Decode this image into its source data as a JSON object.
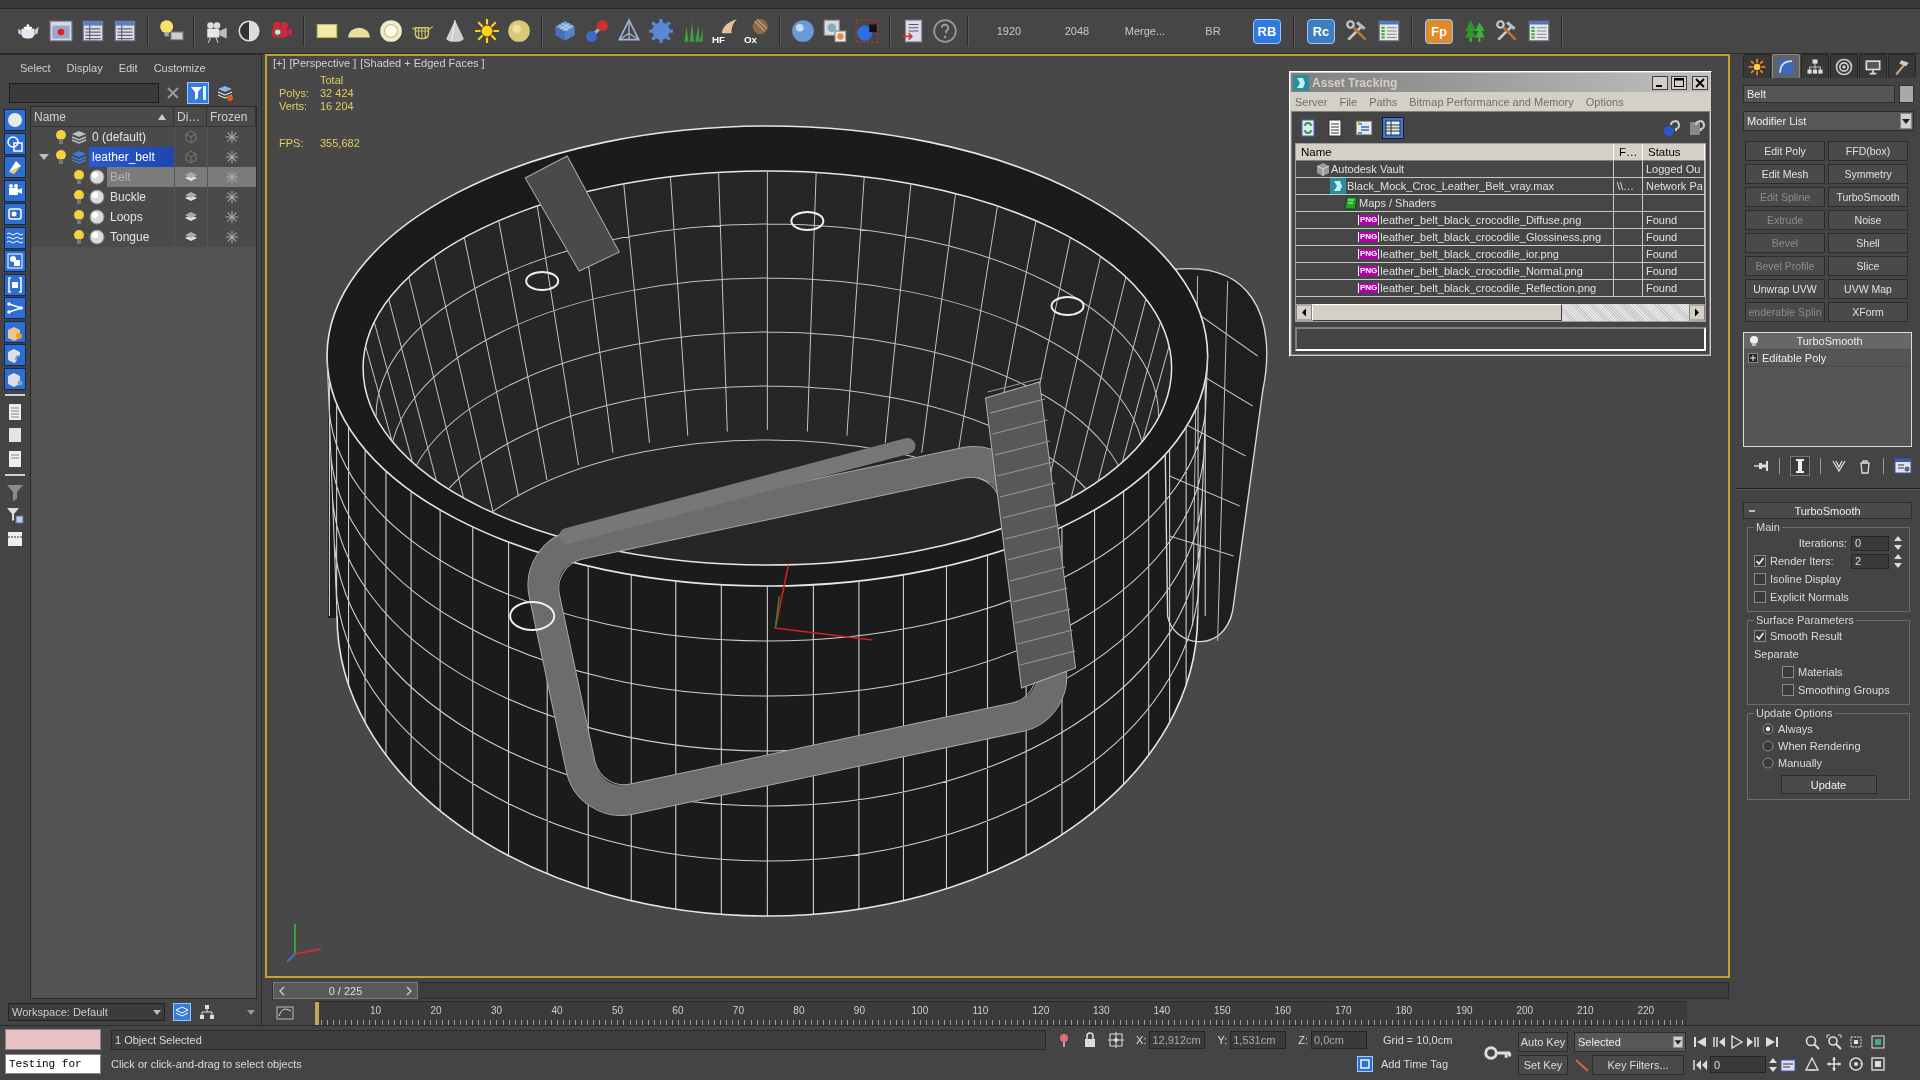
{
  "main_toolbar": {
    "texts": [
      "1920",
      "2048",
      "Merge...",
      "BR"
    ],
    "icon_captions": [
      "HF",
      "Ox"
    ],
    "logo_buttons": [
      {
        "label": "RB",
        "color": "#2d7be0"
      },
      {
        "label": "Rc",
        "color": "#3f7fc0"
      },
      {
        "label": "Fp",
        "color": "#e08a2a"
      }
    ]
  },
  "scene_explorer": {
    "menu": [
      "Select",
      "Display",
      "Edit",
      "Customize"
    ],
    "columns": [
      "Name",
      "Di…",
      "Frozen"
    ],
    "tree": [
      {
        "name": "0 (default)",
        "kind": "layer",
        "visible": true,
        "active": false,
        "selected": false
      },
      {
        "name": "leather_belt",
        "kind": "layer",
        "visible": true,
        "active": true,
        "selected": false,
        "expanded": true,
        "children": [
          {
            "name": "Belt",
            "kind": "object",
            "visible": true,
            "selected": true
          },
          {
            "name": "Buckle",
            "kind": "object",
            "visible": true,
            "selected": false
          },
          {
            "name": "Loops",
            "kind": "object",
            "visible": true,
            "selected": false
          },
          {
            "name": "Tongue",
            "kind": "object",
            "visible": true,
            "selected": false
          }
        ]
      }
    ],
    "workspace": "Workspace: Default"
  },
  "viewport": {
    "active": true,
    "labels": [
      "[+]",
      "[Perspective ]",
      "[Shaded + Edged Faces ]"
    ],
    "stats_heading": "Total",
    "stats": [
      {
        "label": "Polys:",
        "value": "32 424"
      },
      {
        "label": "Verts:",
        "value": "16 204"
      }
    ],
    "fps": {
      "label": "FPS:",
      "value": "355,682"
    }
  },
  "asset_tracking": {
    "title": "Asset Tracking",
    "focused": false,
    "menu": [
      "Server",
      "File",
      "Paths",
      "Bitmap Performance and Memory",
      "Options"
    ],
    "view_modes": [
      {
        "kind": "list",
        "selected": false
      },
      {
        "kind": "tree",
        "selected": false
      },
      {
        "kind": "table",
        "selected": true
      }
    ],
    "columns": [
      "Name",
      "F…",
      "Status"
    ],
    "tree": [
      {
        "name": "Autodesk Vault",
        "kind": "vault",
        "status": "Logged Ou",
        "children": [
          {
            "name": "Black_Mock_Croc_Leather_Belt_vray.max",
            "kind": "scene",
            "column_2": "\\\\…",
            "status": "Network Pa",
            "children": [
              {
                "name": "Maps / Shaders",
                "kind": "folder",
                "children": [
                  {
                    "name": "leather_belt_black_crocodile_Diffuse.png",
                    "kind": "file",
                    "badge": "PNG",
                    "status": "Found"
                  },
                  {
                    "name": "leather_belt_black_crocodile_Glossiness.png",
                    "kind": "file",
                    "badge": "PNG",
                    "status": "Found"
                  },
                  {
                    "name": "leather_belt_black_crocodile_ior.png",
                    "kind": "file",
                    "badge": "PNG",
                    "status": "Found"
                  },
                  {
                    "name": "leather_belt_black_crocodile_Normal.png",
                    "kind": "file",
                    "badge": "PNG",
                    "status": "Found"
                  },
                  {
                    "name": "leather_belt_black_crocodile_Reflection.png",
                    "kind": "file",
                    "badge": "PNG",
                    "status": "Found"
                  }
                ]
              }
            ]
          }
        ]
      }
    ]
  },
  "command_panel": {
    "tabs": [
      {
        "kind": "create",
        "selected": false
      },
      {
        "kind": "modify",
        "selected": true
      },
      {
        "kind": "hierarchy",
        "selected": false
      },
      {
        "kind": "motion",
        "selected": false
      },
      {
        "kind": "display",
        "selected": false
      },
      {
        "kind": "utilities",
        "selected": false
      }
    ],
    "object_name": "Belt",
    "modifier_list": "Modifier List",
    "modifier_buttons": [
      {
        "label": "Edit Poly",
        "disabled": false
      },
      {
        "label": "FFD(box)",
        "disabled": false
      },
      {
        "label": "Edit Mesh",
        "disabled": false
      },
      {
        "label": "Symmetry",
        "disabled": false
      },
      {
        "label": "Edit Spline",
        "disabled": true
      },
      {
        "label": "TurboSmooth",
        "disabled": false
      },
      {
        "label": "Extrude",
        "disabled": true
      },
      {
        "label": "Noise",
        "disabled": false
      },
      {
        "label": "Bevel",
        "disabled": true
      },
      {
        "label": "Shell",
        "disabled": false
      },
      {
        "label": "Bevel Profile",
        "disabled": true
      },
      {
        "label": "Slice",
        "disabled": false
      },
      {
        "label": "Unwrap UVW",
        "disabled": false
      },
      {
        "label": "UVW Map",
        "disabled": false
      },
      {
        "label": "enderable Splin",
        "disabled": true
      },
      {
        "label": "XForm",
        "disabled": false
      }
    ],
    "stack": [
      {
        "name": "TurboSmooth",
        "kind": "modifier",
        "selected": true
      },
      {
        "name": "Editable Poly",
        "kind": "base_object",
        "selected": false
      }
    ],
    "rollout": {
      "title": "TurboSmooth",
      "main": {
        "title": "Main",
        "iterations": {
          "label": "Iterations:",
          "value": "0"
        },
        "render_iters": {
          "label": "Render Iters:",
          "checked": true,
          "value": "2"
        },
        "options": [
          {
            "label": "Isoline Display",
            "checked": false
          },
          {
            "label": "Explicit Normals",
            "checked": false
          }
        ]
      },
      "surface": {
        "title": "Surface Parameters",
        "smooth_result": {
          "label": "Smooth Result",
          "checked": true
        },
        "separate_label": "Separate",
        "separate": [
          {
            "label": "Materials",
            "checked": false
          },
          {
            "label": "Smoothing Groups",
            "checked": false
          }
        ]
      },
      "update": {
        "title": "Update Options",
        "options": [
          {
            "label": "Always",
            "selected": true
          },
          {
            "label": "When Rendering",
            "selected": false
          },
          {
            "label": "Manually",
            "selected": false
          }
        ],
        "button": "Update"
      }
    }
  },
  "timeline": {
    "slider": {
      "label": "0 / 225",
      "level": 0
    },
    "frame_labels": [
      "10",
      "20",
      "30",
      "40",
      "50",
      "60",
      "70",
      "80",
      "90",
      "100",
      "110",
      "120",
      "130",
      "140",
      "150",
      "160",
      "170",
      "180",
      "190",
      "200",
      "210",
      "220"
    ]
  },
  "status_bar": {
    "listener_output": "Testing for",
    "selection": "1 Object Selected",
    "prompt": "Click or click-and-drag to select objects",
    "coordinates": [
      {
        "axis": "X:",
        "value": "12,912cm"
      },
      {
        "axis": "Y:",
        "value": "1,531cm"
      },
      {
        "axis": "Z:",
        "value": "0,0cm"
      }
    ],
    "grid": "Grid = 10,0cm",
    "time_tag": "Add Time Tag",
    "auto_key": "Auto Key",
    "set_key": "Set Key",
    "key_filter_mode": "Selected",
    "key_filters": "Key Filters...",
    "current_frame": "0"
  }
}
